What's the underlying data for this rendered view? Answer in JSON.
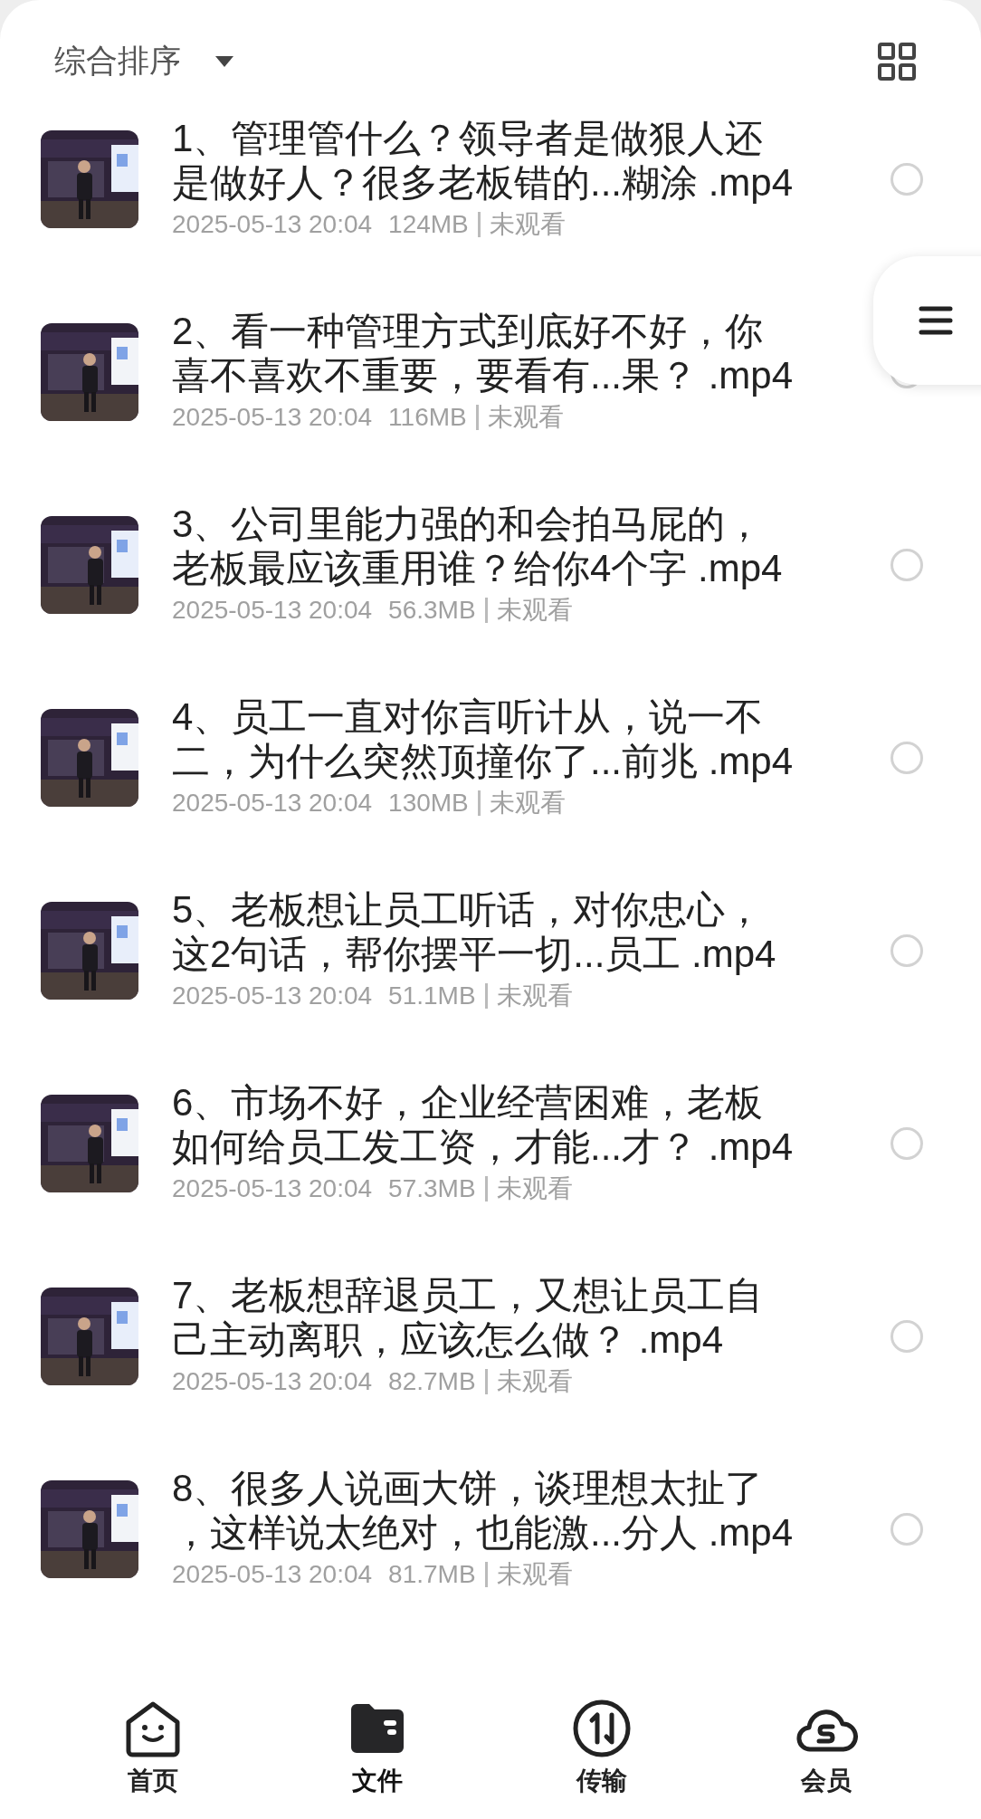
{
  "header": {
    "sort_label": "综合排序"
  },
  "files": [
    {
      "title": "1、管理管什么？领导者是做狠人还是做好人？很多老板错的...糊涂 .mp4",
      "date": "2025-05-13 20:04",
      "size": "124MB",
      "status": "未观看",
      "selected": false
    },
    {
      "title": "2、看一种管理方式到底好不好，你喜不喜欢不重要，要看有...果？ .mp4",
      "date": "2025-05-13 20:04",
      "size": "116MB",
      "status": "未观看",
      "selected": false
    },
    {
      "title": "3、公司里能力强的和会拍马屁的，老板最应该重用谁？给你4个字 .mp4",
      "date": "2025-05-13 20:04",
      "size": "56.3MB",
      "status": "未观看",
      "selected": false
    },
    {
      "title": "4、员工一直对你言听计从，说一不二，为什么突然顶撞你了...前兆 .mp4",
      "date": "2025-05-13 20:04",
      "size": "130MB",
      "status": "未观看",
      "selected": false
    },
    {
      "title": "5、老板想让员工听话，对你忠心，这2句话，帮你摆平一切...员工 .mp4",
      "date": "2025-05-13 20:04",
      "size": "51.1MB",
      "status": "未观看",
      "selected": false
    },
    {
      "title": "6、市场不好，企业经营困难，老板如何给员工发工资，才能...才？ .mp4",
      "date": "2025-05-13 20:04",
      "size": "57.3MB",
      "status": "未观看",
      "selected": false
    },
    {
      "title": "7、老板想辞退员工，又想让员工自己主动离职，应该怎么做？ .mp4",
      "date": "2025-05-13 20:04",
      "size": "82.7MB",
      "status": "未观看",
      "selected": false
    },
    {
      "title": "8、很多人说画大饼，谈理想太扯了，这样说太绝对，也能激...分人 .mp4",
      "date": "2025-05-13 20:04",
      "size": "81.7MB",
      "status": "未观看",
      "selected": false
    }
  ],
  "nav": [
    {
      "kind": "home",
      "label": "首页",
      "selected": false
    },
    {
      "kind": "files",
      "label": "文件",
      "selected": true
    },
    {
      "kind": "transfer",
      "label": "传输",
      "selected": false
    },
    {
      "kind": "vip",
      "label": "会员",
      "selected": false
    }
  ]
}
